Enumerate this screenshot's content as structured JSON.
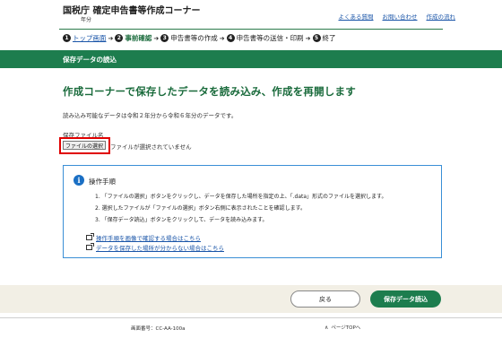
{
  "header": {
    "title": "国税庁 確定申告書等作成コーナー",
    "subtitle": "年分",
    "links": [
      "よくある質問",
      "お問い合わせ",
      "作成の流れ"
    ]
  },
  "steps": [
    {
      "num": "1",
      "label": "トップ画面"
    },
    {
      "num": "2",
      "label": "事前確認"
    },
    {
      "num": "3",
      "label": "申告書等の作成"
    },
    {
      "num": "4",
      "label": "申告書等の送信・印刷"
    },
    {
      "num": "5",
      "label": "終了"
    }
  ],
  "banner": {
    "title": "保存データの読込"
  },
  "main": {
    "heading": "作成コーナーで保存したデータを読み込み、作成を再開します",
    "description": "読み込み可能なデータは令和２年分から令和６年分のデータです。",
    "file_label": "保存ファイル名",
    "file_button": "ファイルの選択",
    "file_status": "ファイルが選択されていません"
  },
  "info": {
    "icon": "info-icon",
    "title": "操作手順",
    "steps": [
      "1. 「ファイルの選択」ボタンをクリックし、データを保存した場所を指定の上、「.data」形式のファイルを選択します。",
      "2. 選択したファイルが「ファイルの選択」ボタン右側に表示されたことを確認します。",
      "3. 「保存データ読込」ボタンをクリックして、データを読み込みます。"
    ],
    "links": [
      "操作手順を画像で確認する場合はこちら",
      "データを保存した場所が分からない場合はこちら"
    ]
  },
  "actions": {
    "back": "戻る",
    "load": "保存データ読込"
  },
  "footer": {
    "screen_no": "画面番号：CC-AA-100a",
    "page_top": "ページTOPへ"
  },
  "colors": {
    "brand_green": "#1d7d4e",
    "highlight_red": "#e00000",
    "link_blue": "#1a55a8",
    "info_blue": "#1a6fc4"
  }
}
